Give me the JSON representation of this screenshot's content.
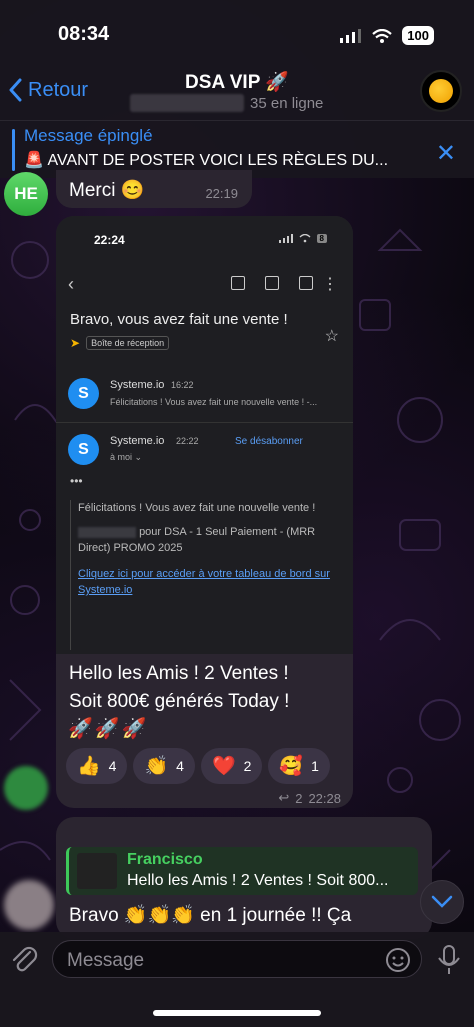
{
  "status_bar": {
    "time": "08:34",
    "battery": "100"
  },
  "header": {
    "back_label": "Retour",
    "title": "DSA VIP 🚀",
    "online": "35 en ligne"
  },
  "pinned": {
    "label": "Message épinglé",
    "text": "🚨 AVANT DE POSTER VOICI LES RÈGLES DU..."
  },
  "messages": {
    "first": {
      "avatar_initials": "HE",
      "text": "Merci 😊",
      "time": "22:19"
    },
    "card": {
      "screenshot": {
        "time": "22:24",
        "battery": "8",
        "subject": "Bravo, vous avez fait une vente !",
        "inbox_label": "Boîte de réception",
        "sender1": {
          "logo": "S",
          "name": "Systeme.io",
          "time": "16:22",
          "preview": "Félicitations ! Vous avez fait une nouvelle vente ! -..."
        },
        "sender2": {
          "logo": "S",
          "name": "Systeme.io",
          "time": "22:22",
          "unsubscribe": "Se désabonner",
          "to": "à moi ⌄"
        },
        "more": "•••",
        "body_line1": "Félicitations ! Vous avez fait une nouvelle vente !",
        "body_line2": "pour DSA - 1 Seul Paiement - (MRR Direct) PROMO 2025",
        "body_link": "Cliquez ici pour accéder à votre tableau de bord sur Systeme.io"
      },
      "text_line1": "Hello les Amis ! 2 Ventes !",
      "text_line2": "Soit 800€ générés Today !",
      "rockets": "🚀🚀🚀",
      "reactions": [
        {
          "emoji": "👍",
          "count": "4"
        },
        {
          "emoji": "👏",
          "count": "4"
        },
        {
          "emoji": "❤️",
          "count": "2"
        },
        {
          "emoji": "🥰",
          "count": "1"
        }
      ],
      "replies": "2",
      "time": "22:28"
    },
    "reply": {
      "quote_name": "Francisco",
      "quote_text": "Hello les Amis ! 2 Ventes ! Soit 800...",
      "text": "Bravo 👏👏👏 en 1 journée !! Ça"
    }
  },
  "composer": {
    "placeholder": "Message"
  },
  "colors": {
    "accent": "#3a8ef5",
    "bubble": "#2b2530",
    "quote_green": "#46d060"
  }
}
